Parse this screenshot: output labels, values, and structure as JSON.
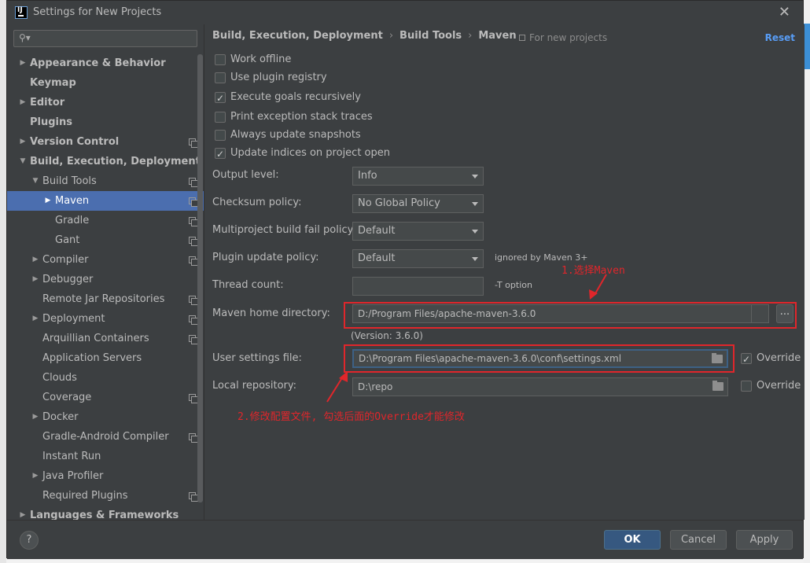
{
  "window": {
    "title": "Settings for New Projects",
    "close": "✕"
  },
  "search": {
    "icon": "search-icon",
    "placeholder": ""
  },
  "sidebar": {
    "items": [
      {
        "label": "Appearance & Behavior",
        "level": 0,
        "arrow": "▶",
        "bold": true,
        "project": false
      },
      {
        "label": "Keymap",
        "level": 0,
        "arrow": "",
        "bold": true,
        "project": false
      },
      {
        "label": "Editor",
        "level": 0,
        "arrow": "▶",
        "bold": true,
        "project": false
      },
      {
        "label": "Plugins",
        "level": 0,
        "arrow": "",
        "bold": true,
        "project": false
      },
      {
        "label": "Version Control",
        "level": 0,
        "arrow": "▶",
        "bold": true,
        "project": true
      },
      {
        "label": "Build, Execution, Deployment",
        "level": 0,
        "arrow": "▼",
        "bold": true,
        "project": false
      },
      {
        "label": "Build Tools",
        "level": 1,
        "arrow": "▼",
        "bold": false,
        "project": true
      },
      {
        "label": "Maven",
        "level": 2,
        "arrow": "▶",
        "bold": false,
        "project": true,
        "selected": true
      },
      {
        "label": "Gradle",
        "level": 2,
        "arrow": "",
        "bold": false,
        "project": true
      },
      {
        "label": "Gant",
        "level": 2,
        "arrow": "",
        "bold": false,
        "project": true
      },
      {
        "label": "Compiler",
        "level": 1,
        "arrow": "▶",
        "bold": false,
        "project": true
      },
      {
        "label": "Debugger",
        "level": 1,
        "arrow": "▶",
        "bold": false,
        "project": false
      },
      {
        "label": "Remote Jar Repositories",
        "level": 1,
        "arrow": "",
        "bold": false,
        "project": true
      },
      {
        "label": "Deployment",
        "level": 1,
        "arrow": "▶",
        "bold": false,
        "project": true
      },
      {
        "label": "Arquillian Containers",
        "level": 1,
        "arrow": "",
        "bold": false,
        "project": true
      },
      {
        "label": "Application Servers",
        "level": 1,
        "arrow": "",
        "bold": false,
        "project": false
      },
      {
        "label": "Clouds",
        "level": 1,
        "arrow": "",
        "bold": false,
        "project": false
      },
      {
        "label": "Coverage",
        "level": 1,
        "arrow": "",
        "bold": false,
        "project": true
      },
      {
        "label": "Docker",
        "level": 1,
        "arrow": "▶",
        "bold": false,
        "project": false
      },
      {
        "label": "Gradle-Android Compiler",
        "level": 1,
        "arrow": "",
        "bold": false,
        "project": true
      },
      {
        "label": "Instant Run",
        "level": 1,
        "arrow": "",
        "bold": false,
        "project": false
      },
      {
        "label": "Java Profiler",
        "level": 1,
        "arrow": "▶",
        "bold": false,
        "project": false
      },
      {
        "label": "Required Plugins",
        "level": 1,
        "arrow": "",
        "bold": false,
        "project": true
      },
      {
        "label": "Languages & Frameworks",
        "level": 0,
        "arrow": "▶",
        "bold": true,
        "project": false
      }
    ]
  },
  "breadcrumb": {
    "part1": "Build, Execution, Deployment",
    "sep": "›",
    "part2": "Build Tools",
    "part3": "Maven"
  },
  "for_new_projects": "For new projects",
  "reset": "Reset",
  "checkboxes": [
    {
      "label": "Work offline",
      "checked": false
    },
    {
      "label": "Use plugin registry",
      "checked": false
    },
    {
      "label": "Execute goals recursively",
      "checked": true
    },
    {
      "label": "Print exception stack traces",
      "checked": false
    },
    {
      "label": "Always update snapshots",
      "checked": false
    },
    {
      "label": "Update indices on project open",
      "checked": true
    }
  ],
  "form": {
    "output_level": {
      "label": "Output level:",
      "value": "Info"
    },
    "checksum_policy": {
      "label": "Checksum policy:",
      "value": "No Global Policy"
    },
    "multiproject_fail": {
      "label": "Multiproject build fail policy:",
      "value": "Default"
    },
    "plugin_update": {
      "label": "Plugin update policy:",
      "value": "Default",
      "note": "ignored by Maven 3+"
    },
    "thread_count": {
      "label": "Thread count:",
      "value": "",
      "note": "-T option"
    },
    "maven_home": {
      "label": "Maven home directory:",
      "value": "D:/Program Files/apache-maven-3.6.0",
      "button": "...",
      "version": "(Version: 3.6.0)"
    },
    "user_settings": {
      "label": "User settings file:",
      "value": "D:\\Program Files\\apache-maven-3.6.0\\conf\\settings.xml",
      "override_label": "Override",
      "override_checked": true
    },
    "local_repo": {
      "label": "Local repository:",
      "value": "D:\\repo",
      "override_label": "Override",
      "override_checked": false
    }
  },
  "annotations": {
    "note1": "1.选择Maven",
    "note2": "2.修改配置文件, 勾选后面的Override才能修改",
    "color": "#e0262b"
  },
  "buttons": {
    "help": "?",
    "ok": "OK",
    "cancel": "Cancel",
    "apply": "Apply"
  },
  "colors": {
    "background": "#3c3f41",
    "selection": "#4b6eaf",
    "link": "#589df6",
    "primary_button": "#365880"
  }
}
